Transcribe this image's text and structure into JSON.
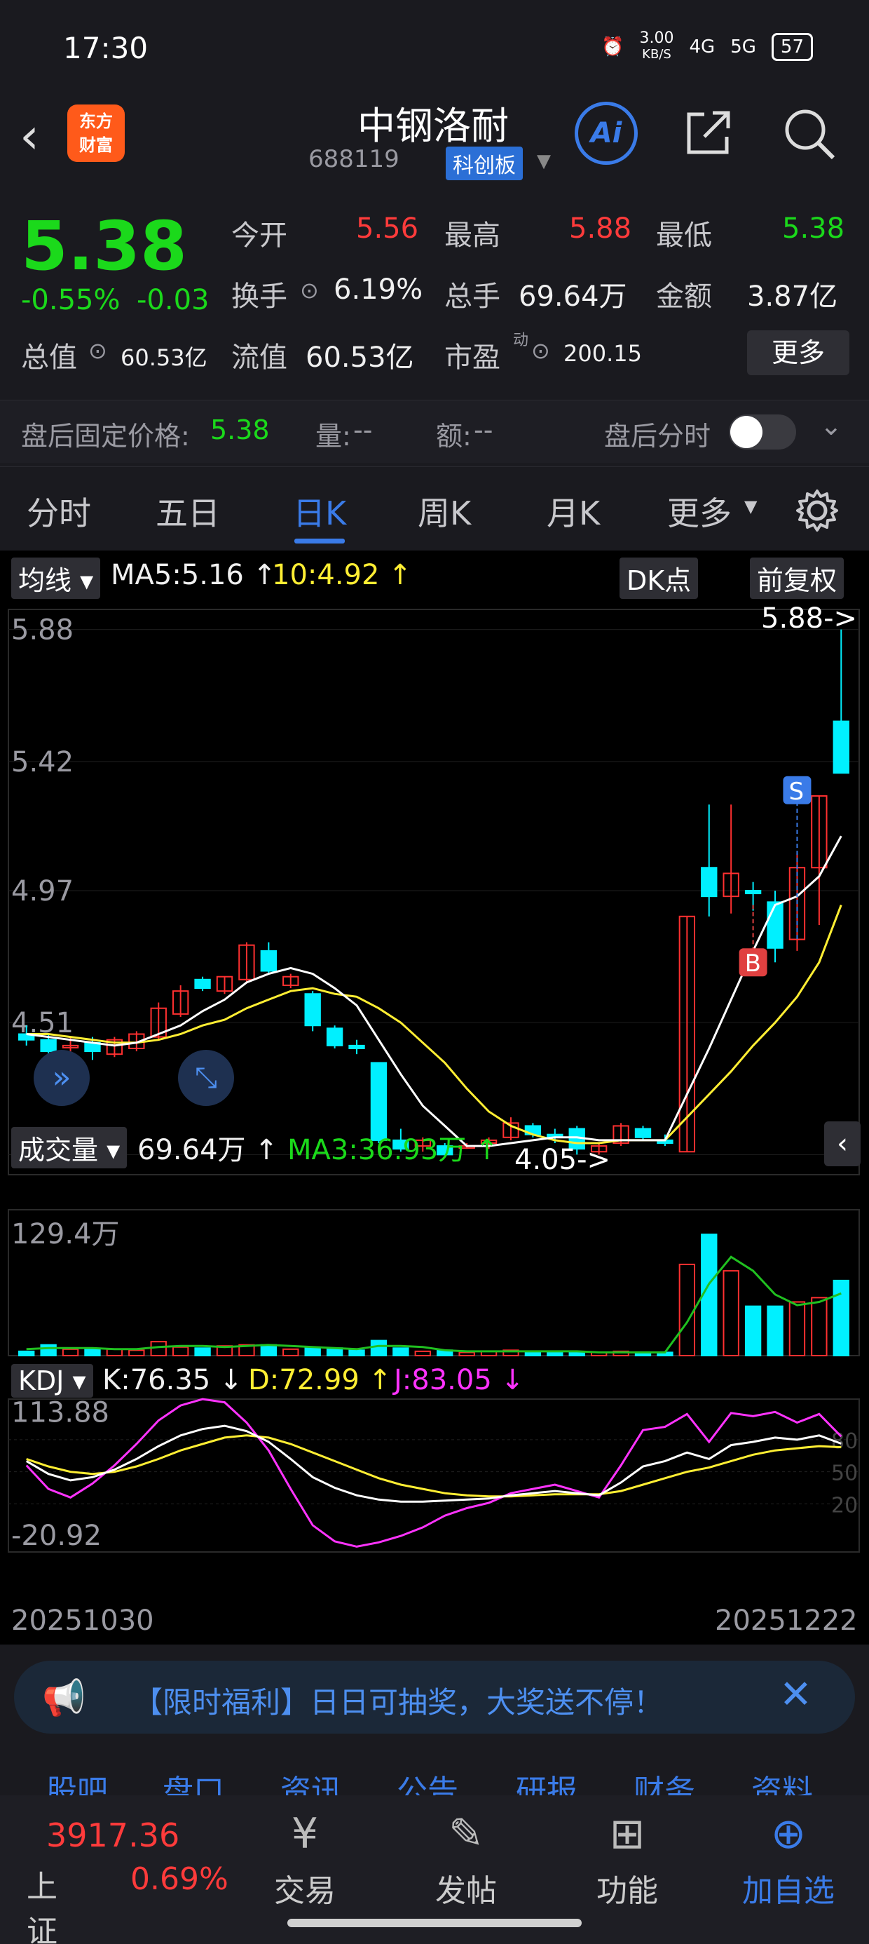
{
  "status": {
    "time": "17:30",
    "net_speed": "3.00",
    "net_unit": "KB/S",
    "signal1": "4G",
    "signal2": "5G",
    "battery": "57"
  },
  "header": {
    "back": "‹",
    "logo_line1": "东方",
    "logo_line2": "财富",
    "name": "中钢洛耐",
    "code": "688119",
    "board": "科创板",
    "ai": "Ai"
  },
  "quote": {
    "price": "5.38",
    "change_pct": "-0.55%",
    "change": "-0.03",
    "open_label": "今开",
    "open": "5.56",
    "high_label": "最高",
    "high": "5.88",
    "low_label": "最低",
    "low": "5.38",
    "turnover_label": "换手",
    "turnover": "6.19%",
    "volume_label": "总手",
    "volume": "69.64万",
    "amount_label": "金额",
    "amount": "3.87亿",
    "mktcap_label": "总值",
    "mktcap": "60.53亿",
    "float_label": "流值",
    "float": "60.53亿",
    "pe_label": "市盈",
    "pe_sup": "动",
    "pe": "200.15",
    "more": "更多"
  },
  "after_hours": {
    "label": "盘后固定价格:",
    "price": "5.38",
    "vol_label": "量:",
    "vol": "--",
    "amt_label": "额:",
    "amt": "--",
    "time_label": "盘后分时"
  },
  "tabs": [
    "分时",
    "五日",
    "日K",
    "周K",
    "月K",
    "更多"
  ],
  "chart": {
    "ma_btn": "均线",
    "ma5": "MA5:5.16",
    "ma10": "10:4.92",
    "dk_btn": "DK点",
    "adj_btn": "前复权",
    "high_mark": "5.88->",
    "low_mark": "4.05->",
    "sell_mark": "S",
    "buy_mark": "B",
    "vol_btn": "成交量",
    "vol_val": "69.64万",
    "vol_ma": "MA3:36.93万",
    "vol_max": "129.4万",
    "kdj_btn": "KDJ",
    "k": "K:76.35",
    "d": "D:72.99",
    "j": "J:83.05",
    "kdj_max": "113.88",
    "kdj_min": "-20.92",
    "kdj_ref": [
      "80",
      "50",
      "20"
    ],
    "date_start": "20251030",
    "date_end": "20251222"
  },
  "chart_data": {
    "type": "candlestick",
    "price_axis_ticks": [
      5.88,
      5.42,
      4.97,
      4.51,
      4.05
    ],
    "candles": [
      {
        "o": 4.47,
        "c": 4.45,
        "h": 4.5,
        "l": 4.43,
        "v": 4
      },
      {
        "o": 4.45,
        "c": 4.41,
        "h": 4.47,
        "l": 4.38,
        "v": 10
      },
      {
        "o": 4.43,
        "c": 4.43,
        "h": 4.46,
        "l": 4.34,
        "v": 6
      },
      {
        "o": 4.44,
        "c": 4.41,
        "h": 4.46,
        "l": 4.38,
        "v": 6
      },
      {
        "o": 4.4,
        "c": 4.45,
        "h": 4.46,
        "l": 4.39,
        "v": 6
      },
      {
        "o": 4.42,
        "c": 4.47,
        "h": 4.48,
        "l": 4.41,
        "v": 5
      },
      {
        "o": 4.46,
        "c": 4.56,
        "h": 4.58,
        "l": 4.45,
        "v": 13
      },
      {
        "o": 4.54,
        "c": 4.62,
        "h": 4.64,
        "l": 4.53,
        "v": 8
      },
      {
        "o": 4.66,
        "c": 4.63,
        "h": 4.67,
        "l": 4.62,
        "v": 7
      },
      {
        "o": 4.62,
        "c": 4.67,
        "h": 4.67,
        "l": 4.61,
        "v": 9
      },
      {
        "o": 4.66,
        "c": 4.78,
        "h": 4.79,
        "l": 4.65,
        "v": 10
      },
      {
        "o": 4.76,
        "c": 4.69,
        "h": 4.79,
        "l": 4.68,
        "v": 10
      },
      {
        "o": 4.64,
        "c": 4.67,
        "h": 4.68,
        "l": 4.63,
        "v": 6
      },
      {
        "o": 4.61,
        "c": 4.5,
        "h": 4.62,
        "l": 4.48,
        "v": 7
      },
      {
        "o": 4.49,
        "c": 4.43,
        "h": 4.5,
        "l": 4.42,
        "v": 7
      },
      {
        "o": 4.43,
        "c": 4.42,
        "h": 4.45,
        "l": 4.4,
        "v": 5
      },
      {
        "o": 4.37,
        "c": 4.1,
        "h": 4.37,
        "l": 4.09,
        "v": 14
      },
      {
        "o": 4.1,
        "c": 4.07,
        "h": 4.14,
        "l": 4.06,
        "v": 7
      },
      {
        "o": 4.08,
        "c": 4.1,
        "h": 4.11,
        "l": 4.06,
        "v": 4
      },
      {
        "o": 4.08,
        "c": 4.05,
        "h": 4.09,
        "l": 4.05,
        "v": 5
      },
      {
        "o": 4.08,
        "c": 4.08,
        "h": 4.09,
        "l": 4.07,
        "v": 3
      },
      {
        "o": 4.09,
        "c": 4.1,
        "h": 4.11,
        "l": 4.07,
        "v": 4
      },
      {
        "o": 4.11,
        "c": 4.16,
        "h": 4.18,
        "l": 4.1,
        "v": 5
      },
      {
        "o": 4.15,
        "c": 4.12,
        "h": 4.16,
        "l": 4.11,
        "v": 3
      },
      {
        "o": 4.12,
        "c": 4.11,
        "h": 4.14,
        "l": 4.09,
        "v": 3
      },
      {
        "o": 4.14,
        "c": 4.07,
        "h": 4.15,
        "l": 4.05,
        "v": 3
      },
      {
        "o": 4.06,
        "c": 4.08,
        "h": 4.09,
        "l": 4.05,
        "v": 3
      },
      {
        "o": 4.09,
        "c": 4.15,
        "h": 4.16,
        "l": 4.08,
        "v": 4
      },
      {
        "o": 4.14,
        "c": 4.11,
        "h": 4.15,
        "l": 4.1,
        "v": 3
      },
      {
        "o": 4.1,
        "c": 4.09,
        "h": 4.12,
        "l": 4.08,
        "v": 3
      },
      {
        "o": 4.06,
        "c": 4.88,
        "h": 4.88,
        "l": 4.06,
        "v": 85
      },
      {
        "o": 5.05,
        "c": 4.95,
        "h": 5.27,
        "l": 4.88,
        "v": 113
      },
      {
        "o": 4.95,
        "c": 5.03,
        "h": 5.27,
        "l": 4.89,
        "v": 79
      },
      {
        "o": 4.97,
        "c": 4.96,
        "h": 5.0,
        "l": 4.9,
        "v": 46
      },
      {
        "o": 4.93,
        "c": 4.77,
        "h": 4.97,
        "l": 4.72,
        "v": 46
      },
      {
        "o": 4.8,
        "c": 5.05,
        "h": 5.1,
        "l": 4.76,
        "v": 50
      },
      {
        "o": 5.05,
        "c": 5.3,
        "h": 5.3,
        "l": 4.85,
        "v": 54
      },
      {
        "o": 5.56,
        "c": 5.38,
        "h": 5.88,
        "l": 5.38,
        "v": 70
      }
    ],
    "ma5": [
      4.47,
      4.46,
      4.45,
      4.44,
      4.43,
      4.44,
      4.47,
      4.5,
      4.55,
      4.59,
      4.65,
      4.68,
      4.7,
      4.68,
      4.63,
      4.57,
      4.45,
      4.33,
      4.22,
      4.15,
      4.08,
      4.08,
      4.09,
      4.1,
      4.11,
      4.11,
      4.1,
      4.1,
      4.1,
      4.1,
      4.26,
      4.42,
      4.59,
      4.76,
      4.92,
      4.95,
      5.02,
      5.16
    ],
    "ma10": [
      4.47,
      4.47,
      4.46,
      4.45,
      4.44,
      4.44,
      4.45,
      4.47,
      4.5,
      4.52,
      4.56,
      4.59,
      4.62,
      4.63,
      4.61,
      4.6,
      4.56,
      4.51,
      4.44,
      4.37,
      4.28,
      4.2,
      4.15,
      4.12,
      4.1,
      4.09,
      4.09,
      4.1,
      4.1,
      4.1,
      4.18,
      4.26,
      4.34,
      4.43,
      4.51,
      4.6,
      4.72,
      4.92
    ],
    "vol_ma3": [
      6,
      7,
      7,
      7,
      6,
      6,
      8,
      9,
      9,
      8,
      9,
      10,
      9,
      8,
      7,
      6,
      9,
      9,
      8,
      5,
      4,
      4,
      4,
      4,
      4,
      4,
      3,
      3,
      3,
      3,
      31,
      67,
      92,
      79,
      57,
      47,
      50,
      58
    ],
    "kdj_k": [
      60,
      48,
      42,
      45,
      52,
      62,
      74,
      84,
      90,
      93,
      88,
      78,
      62,
      45,
      35,
      28,
      24,
      22,
      22,
      23,
      24,
      25,
      28,
      30,
      32,
      30,
      28,
      40,
      55,
      60,
      68,
      62,
      75,
      78,
      82,
      80,
      84,
      76.35
    ],
    "kdj_d": [
      62,
      55,
      50,
      48,
      50,
      55,
      62,
      70,
      76,
      82,
      84,
      82,
      76,
      68,
      60,
      52,
      44,
      38,
      34,
      30,
      28,
      27,
      27,
      28,
      29,
      29,
      29,
      32,
      38,
      44,
      50,
      54,
      60,
      66,
      70,
      72,
      74,
      72.99
    ],
    "kdj_j": [
      56,
      34,
      26,
      39,
      56,
      76,
      98,
      112,
      118,
      115,
      96,
      70,
      34,
      0,
      -15,
      -20,
      -16,
      -10,
      -2,
      9,
      16,
      21,
      30,
      34,
      38,
      32,
      26,
      56,
      89,
      92,
      104,
      78,
      105,
      102,
      106,
      96,
      104,
      83.05
    ]
  },
  "banner": {
    "text": "【限时福利】日日可抽奖，大奖送不停！"
  },
  "subtabs": [
    "股吧",
    "盘口",
    "资讯",
    "公告",
    "研报",
    "财务",
    "资料"
  ],
  "bottom": {
    "index_value": "3917.36",
    "index_name": "上证",
    "index_pct": "0.69%",
    "items": [
      "交易",
      "发帖",
      "功能",
      "加自选"
    ]
  }
}
